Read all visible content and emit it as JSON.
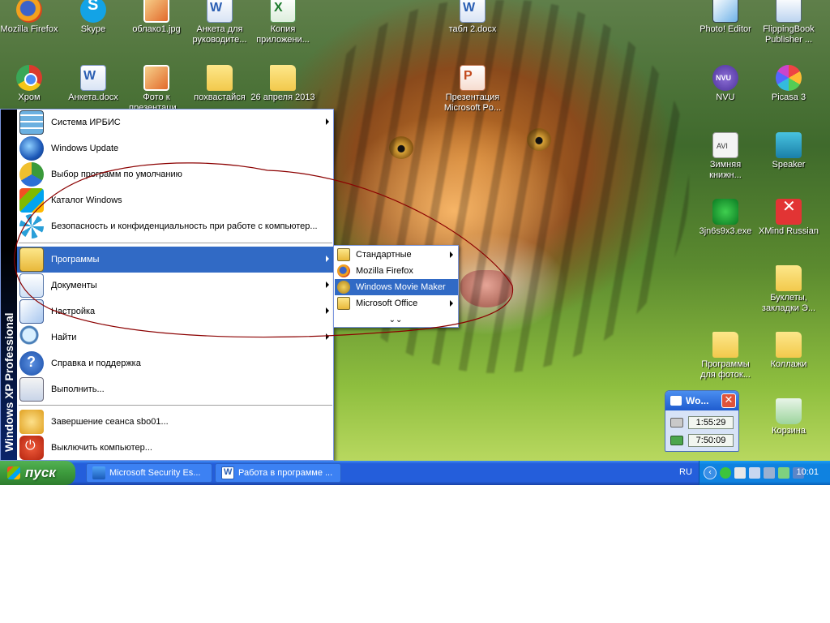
{
  "desktop": {
    "icons": [
      {
        "label": "Mozilla Firefox"
      },
      {
        "label": "Skype"
      },
      {
        "label": "облако1.jpg"
      },
      {
        "label": "Анкета для руководите..."
      },
      {
        "label": "Копия приложени..."
      },
      {
        "label": "табл 2.docx"
      },
      {
        "label": "Photo! Editor"
      },
      {
        "label": "FlippingBook Publisher ..."
      },
      {
        "label": "Хром"
      },
      {
        "label": "Анкета.docx"
      },
      {
        "label": "Фото к презентаци..."
      },
      {
        "label": "похвастайся"
      },
      {
        "label": "26 апреля 2013"
      },
      {
        "label": "Презентация Microsoft Po..."
      },
      {
        "label": "NVU"
      },
      {
        "label": "Picasa 3"
      },
      {
        "label": "Зимняя книжн..."
      },
      {
        "label": "Speaker"
      },
      {
        "label": "3jn6s9x3.exe"
      },
      {
        "label": "XMind Russian"
      },
      {
        "label": "Буклеты, закладки Э..."
      },
      {
        "label": "Программы для фоток..."
      },
      {
        "label": "Коллажи"
      },
      {
        "label": "Корзина"
      }
    ]
  },
  "start_menu": {
    "side_text": "Windows XP Professional",
    "items": [
      {
        "label": "Система ИРБИС"
      },
      {
        "label": "Windows Update"
      },
      {
        "label": "Выбор программ по умолчанию"
      },
      {
        "label": "Каталог Windows"
      },
      {
        "label": "Безопасность и конфиденциальность при работе с компьютер..."
      },
      {
        "label": "Программы"
      },
      {
        "label": "Документы"
      },
      {
        "label": "Настройка"
      },
      {
        "label": "Найти"
      },
      {
        "label": "Справка и поддержка"
      },
      {
        "label": "Выполнить..."
      },
      {
        "label": "Завершение сеанса sbo01..."
      },
      {
        "label": "Выключить компьютер..."
      }
    ],
    "highlight_color": "#316ac5"
  },
  "programs_submenu": {
    "items": [
      {
        "label": "Стандартные"
      },
      {
        "label": "Mozilla Firefox"
      },
      {
        "label": "Windows Movie Maker"
      },
      {
        "label": "Microsoft Office"
      }
    ],
    "more_glyph": "⌄⌄"
  },
  "taskbar": {
    "start_label": "пуск",
    "tasks": [
      {
        "label": "Microsoft Security Es..."
      },
      {
        "label": "Работа в программе ..."
      }
    ],
    "language": "RU",
    "tray_toggle": "‹",
    "clock": "10:01",
    "color": "#245edb"
  },
  "timer_widget": {
    "title": "Wo...",
    "close_glyph": "✕",
    "time_1": "1:55:29",
    "time_2": "7:50:09"
  },
  "annotation": {
    "stroke_color": "#8b0000"
  }
}
